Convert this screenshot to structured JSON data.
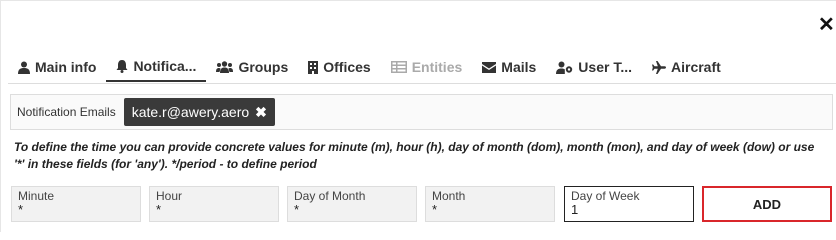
{
  "window": {
    "close_symbol": "✕"
  },
  "tabs": [
    {
      "label": "Main info",
      "icon": "user-icon",
      "state": "normal"
    },
    {
      "label": "Notifica...",
      "icon": "bell-icon",
      "state": "active"
    },
    {
      "label": "Groups",
      "icon": "users-icon",
      "state": "normal"
    },
    {
      "label": "Offices",
      "icon": "building-icon",
      "state": "normal"
    },
    {
      "label": "Entities",
      "icon": "grid-icon",
      "state": "disabled"
    },
    {
      "label": "Mails",
      "icon": "envelope-icon",
      "state": "normal"
    },
    {
      "label": "User T...",
      "icon": "user-cog-icon",
      "state": "normal"
    },
    {
      "label": "Aircraft",
      "icon": "plane-icon",
      "state": "normal"
    }
  ],
  "notification_emails": {
    "label": "Notification Emails",
    "chips": [
      {
        "value": "kate.r@awery.aero",
        "remove_symbol": "✖"
      }
    ]
  },
  "help_text": "To define the time you can provide concrete values for minute (m), hour (h), day of month (dom), month (mon), and day of week (dow) or use '*' in these fields (for 'any'). */period - to define period",
  "schedule_fields": {
    "minute": {
      "label": "Minute",
      "value": "*"
    },
    "hour": {
      "label": "Hour",
      "value": "*"
    },
    "day_of_month": {
      "label": "Day of Month",
      "value": "*"
    },
    "month": {
      "label": "Month",
      "value": "*"
    },
    "day_of_week": {
      "label": "Day of Week",
      "value": "1"
    }
  },
  "add_button": {
    "label": "ADD"
  },
  "colors": {
    "accent_border": "#d9262b",
    "chip_bg": "#3a3a3a"
  }
}
